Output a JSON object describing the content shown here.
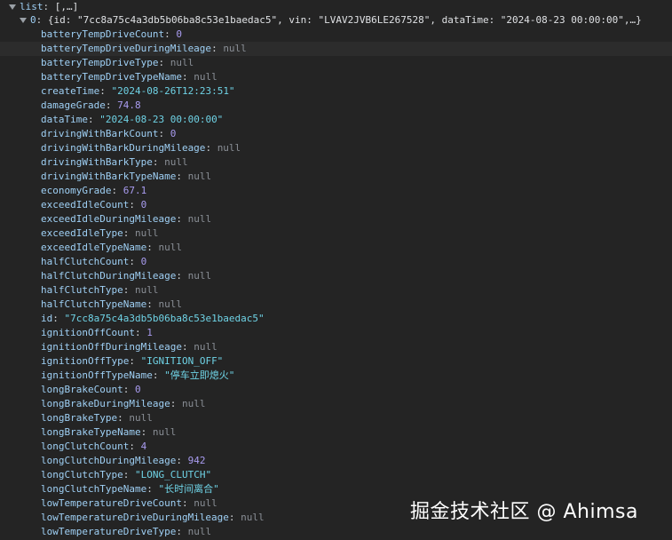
{
  "list_header": {
    "key": "list",
    "sep": ":",
    "summary": "[,…]"
  },
  "item0": {
    "index": "0",
    "summary": "{id: \"7cc8a75c4a3db5b06ba8c53e1baedac5\", vin: \"LVAV2JVB6LE267528\", dataTime: \"2024-08-23 00:00:00\",…}"
  },
  "fields": [
    {
      "key": "batteryTempDriveCount",
      "value": "0",
      "type": "num"
    },
    {
      "key": "batteryTempDriveDuringMileage",
      "value": "null",
      "type": "nul"
    },
    {
      "key": "batteryTempDriveType",
      "value": "null",
      "type": "nul"
    },
    {
      "key": "batteryTempDriveTypeName",
      "value": "null",
      "type": "nul"
    },
    {
      "key": "createTime",
      "value": "\"2024-08-26T12:23:51\"",
      "type": "str"
    },
    {
      "key": "damageGrade",
      "value": "74.8",
      "type": "num"
    },
    {
      "key": "dataTime",
      "value": "\"2024-08-23 00:00:00\"",
      "type": "str"
    },
    {
      "key": "drivingWithBarkCount",
      "value": "0",
      "type": "num"
    },
    {
      "key": "drivingWithBarkDuringMileage",
      "value": "null",
      "type": "nul"
    },
    {
      "key": "drivingWithBarkType",
      "value": "null",
      "type": "nul"
    },
    {
      "key": "drivingWithBarkTypeName",
      "value": "null",
      "type": "nul"
    },
    {
      "key": "economyGrade",
      "value": "67.1",
      "type": "num"
    },
    {
      "key": "exceedIdleCount",
      "value": "0",
      "type": "num"
    },
    {
      "key": "exceedIdleDuringMileage",
      "value": "null",
      "type": "nul"
    },
    {
      "key": "exceedIdleType",
      "value": "null",
      "type": "nul"
    },
    {
      "key": "exceedIdleTypeName",
      "value": "null",
      "type": "nul"
    },
    {
      "key": "halfClutchCount",
      "value": "0",
      "type": "num"
    },
    {
      "key": "halfClutchDuringMileage",
      "value": "null",
      "type": "nul"
    },
    {
      "key": "halfClutchType",
      "value": "null",
      "type": "nul"
    },
    {
      "key": "halfClutchTypeName",
      "value": "null",
      "type": "nul"
    },
    {
      "key": "id",
      "value": "\"7cc8a75c4a3db5b06ba8c53e1baedac5\"",
      "type": "str"
    },
    {
      "key": "ignitionOffCount",
      "value": "1",
      "type": "num"
    },
    {
      "key": "ignitionOffDuringMileage",
      "value": "null",
      "type": "nul"
    },
    {
      "key": "ignitionOffType",
      "value": "\"IGNITION_OFF\"",
      "type": "str"
    },
    {
      "key": "ignitionOffTypeName",
      "value": "\"停车立即熄火\"",
      "type": "str"
    },
    {
      "key": "longBrakeCount",
      "value": "0",
      "type": "num"
    },
    {
      "key": "longBrakeDuringMileage",
      "value": "null",
      "type": "nul"
    },
    {
      "key": "longBrakeType",
      "value": "null",
      "type": "nul"
    },
    {
      "key": "longBrakeTypeName",
      "value": "null",
      "type": "nul"
    },
    {
      "key": "longClutchCount",
      "value": "4",
      "type": "num"
    },
    {
      "key": "longClutchDuringMileage",
      "value": "942",
      "type": "num"
    },
    {
      "key": "longClutchType",
      "value": "\"LONG_CLUTCH\"",
      "type": "str"
    },
    {
      "key": "longClutchTypeName",
      "value": "\"长时间离合\"",
      "type": "str"
    },
    {
      "key": "lowTemperatureDriveCount",
      "value": "null",
      "type": "nul"
    },
    {
      "key": "lowTemperatureDriveDuringMileage",
      "value": "null",
      "type": "nul"
    },
    {
      "key": "lowTemperatureDriveType",
      "value": "null",
      "type": "nul"
    }
  ],
  "watermark": "掘金技术社区 @ Ahimsa"
}
